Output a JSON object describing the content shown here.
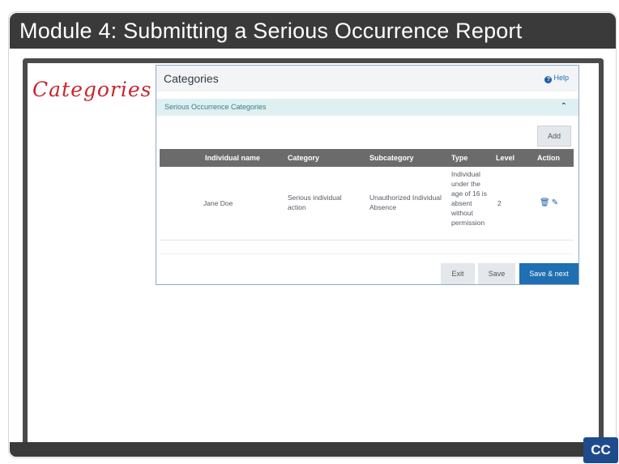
{
  "module_title": "Module 4:  Submitting a Serious Occurrence Report",
  "handwritten_label": "Categories",
  "cc_label": "CC",
  "app": {
    "title": "Categories",
    "help_label": "Help",
    "section_title": "Serious Occurrence Categories",
    "add_label": "Add",
    "columns": [
      "Individual name",
      "Category",
      "Subcategory",
      "Type",
      "Level",
      "Action"
    ],
    "rows": [
      {
        "individual_name": "Jane Doe",
        "category": "Serious individual action",
        "subcategory": "Unauthorized Individual Absence",
        "type": "Individual under the age of 16 is absent without permission",
        "level": "2"
      }
    ],
    "buttons": {
      "exit": "Exit",
      "save": "Save",
      "save_next": "Save & next"
    }
  },
  "icons": {
    "help": "help-icon",
    "collapse": "chevron-up-icon",
    "delete": "trash-icon",
    "edit": "pencil-icon"
  },
  "colors": {
    "title_bar": "#3a3a3a",
    "accent_blue": "#1f6fb2",
    "section_bg": "#dff0f1",
    "handwritten_red": "#c8262c"
  }
}
